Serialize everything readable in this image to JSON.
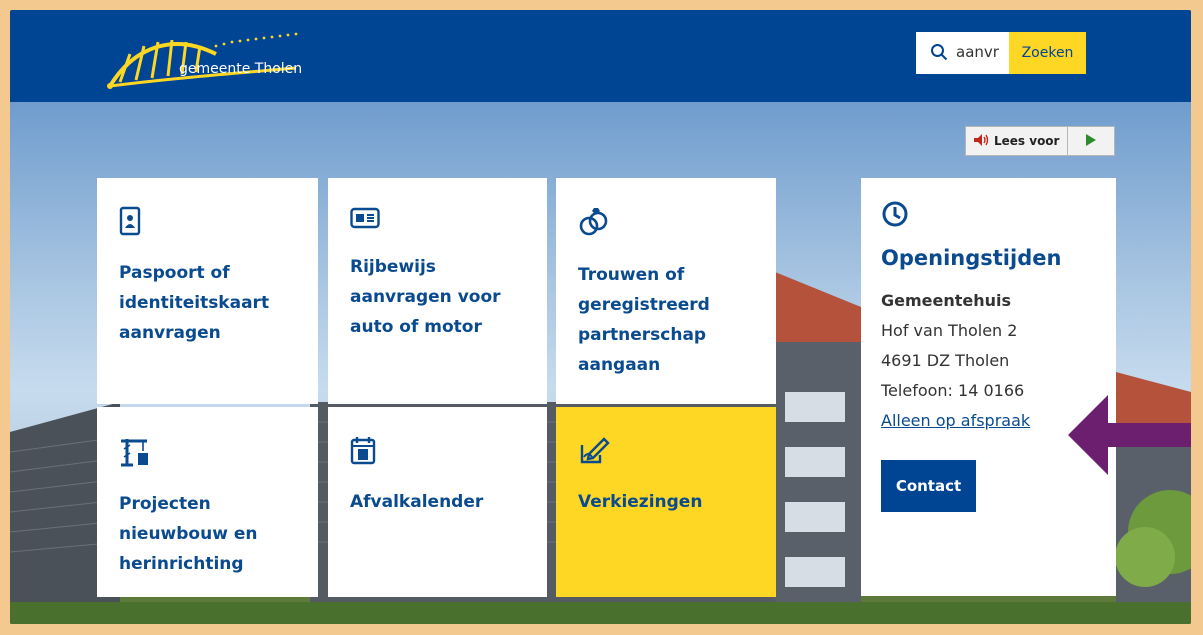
{
  "header": {
    "logo_text": "gemeente Tholen",
    "search_value": "aanvr",
    "search_button": "Zoeken"
  },
  "readaloud": {
    "label": "Lees voor"
  },
  "tiles": [
    {
      "title": "Paspoort of identiteitskaart aanvragen",
      "icon": "passport-icon"
    },
    {
      "title": "Rijbewijs aanvragen voor auto of motor",
      "icon": "driving-license-icon"
    },
    {
      "title": "Trouwen of geregistreerd partnerschap aangaan",
      "icon": "wedding-rings-icon"
    },
    {
      "title": "Projecten nieuwbouw en herinrichting",
      "icon": "construction-crane-icon"
    },
    {
      "title": "Afvalkalender",
      "icon": "calendar-icon"
    },
    {
      "title": "Verkiezingen",
      "icon": "ballot-pen-icon"
    }
  ],
  "hours": {
    "title": "Openingstijden",
    "place": "Gemeentehuis",
    "address1": "Hof van Tholen 2",
    "address2": "4691 DZ Tholen",
    "phone": "Telefoon: 14 0166",
    "appointment_link": "Alleen op afspraak",
    "contact_button": "Contact"
  },
  "colors": {
    "header_bg": "#004494",
    "accent_yellow": "#fdd724",
    "link_blue": "#0a4a8f",
    "frame": "#f4c98f",
    "arrow": "#6b1f6e"
  }
}
